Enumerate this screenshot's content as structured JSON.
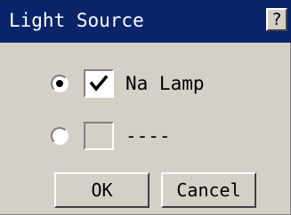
{
  "window": {
    "title": "Light Source",
    "help_label": "?"
  },
  "options": [
    {
      "label": "Na Lamp",
      "radio_selected": true,
      "checked": true
    },
    {
      "label": "----",
      "radio_selected": false,
      "checked": false
    }
  ],
  "buttons": {
    "ok_label": "OK",
    "cancel_label": "Cancel"
  },
  "colors": {
    "titlebar": "#0a246a",
    "dialog_bg": "#d4d0c8",
    "title_text": "#ffffff"
  }
}
